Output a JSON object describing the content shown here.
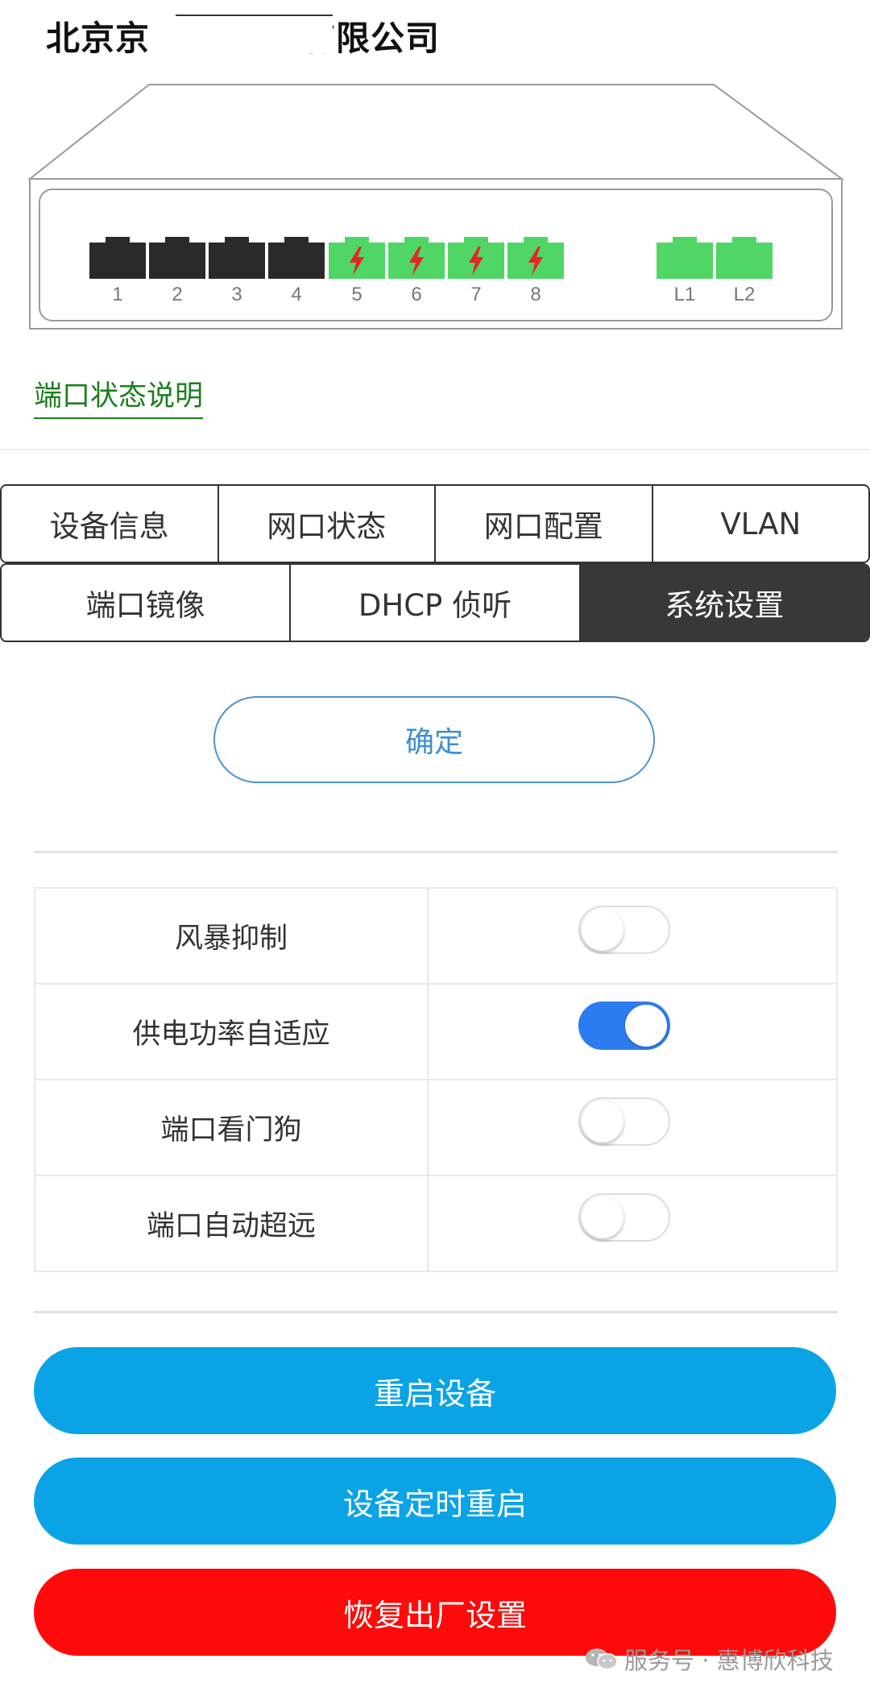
{
  "header": {
    "company": "北京京­­            有限公司"
  },
  "ports": [
    {
      "label": "1",
      "state": "off"
    },
    {
      "label": "2",
      "state": "off"
    },
    {
      "label": "3",
      "state": "off"
    },
    {
      "label": "4",
      "state": "off"
    },
    {
      "label": "5",
      "state": "poe"
    },
    {
      "label": "6",
      "state": "poe"
    },
    {
      "label": "7",
      "state": "poe"
    },
    {
      "label": "8",
      "state": "poe"
    },
    {
      "label": "L1",
      "state": "on"
    },
    {
      "label": "L2",
      "state": "on"
    }
  ],
  "port_status_link": "端口状态说明",
  "tabs_row1": [
    "设备信息",
    "网口状态",
    "网口配置",
    "VLAN"
  ],
  "tabs_row2": [
    "端口镜像",
    "DHCP 侦听",
    "系统设置"
  ],
  "active_tab": "系统设置",
  "confirm_label": "确定",
  "settings": [
    {
      "label": "风暴抑制",
      "on": false
    },
    {
      "label": "供电功率自适应",
      "on": true
    },
    {
      "label": "端口看门狗",
      "on": false
    },
    {
      "label": "端口自动超远",
      "on": false
    }
  ],
  "buttons": {
    "restart": "重启设备",
    "scheduled_restart": "设备定时重启",
    "factory_reset": "恢复出厂设置"
  },
  "watermark": "服务号 · 惠博欣科技",
  "colors": {
    "port_on": "#4fd665",
    "port_off": "#2a2a2a",
    "poe_bolt": "#e8261e",
    "toggle_on": "#2c7cf0",
    "primary_button": "#0aa3e6",
    "danger_button": "#ff0a0a",
    "link_green": "#1c7f1c"
  }
}
